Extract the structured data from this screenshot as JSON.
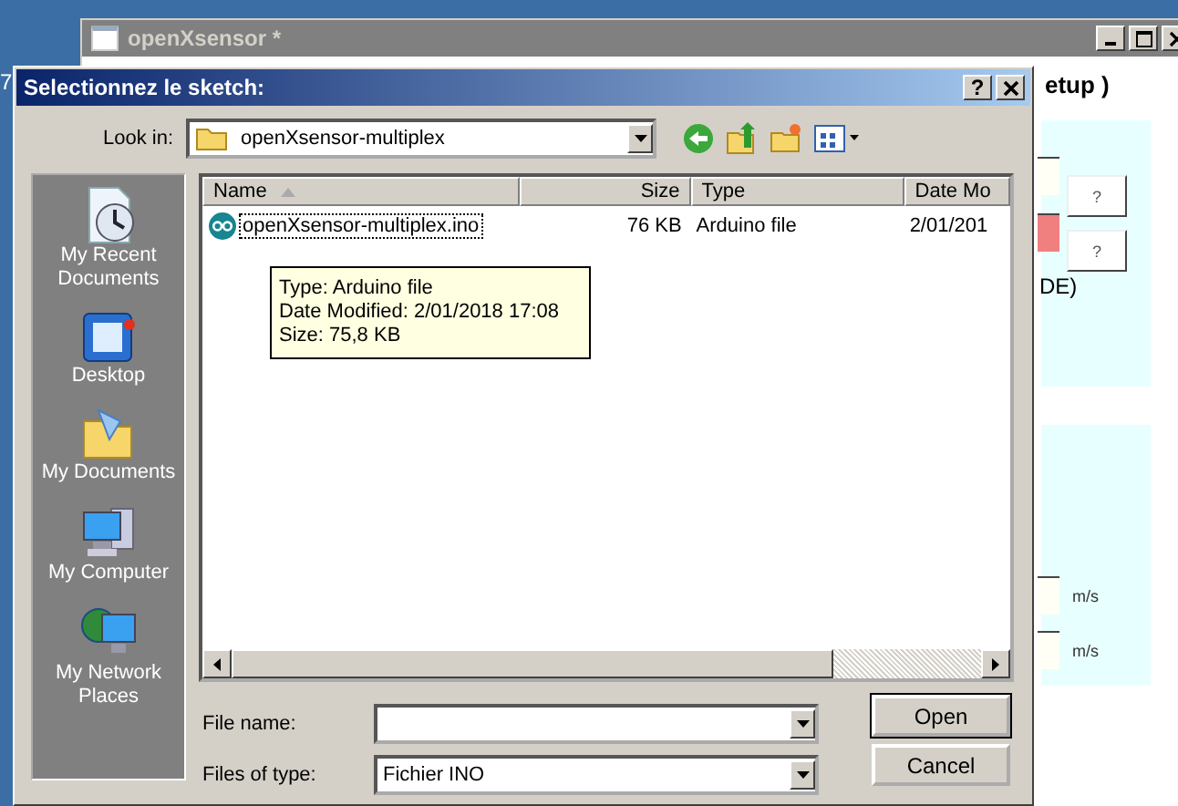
{
  "desktop_fragment": "7",
  "background_window": {
    "title": "openXsensor *",
    "heading_fragment": "etup )",
    "help_buttons": [
      "?",
      "?"
    ],
    "text_fragment": "DE)",
    "units": [
      "m/s",
      "m/s"
    ]
  },
  "dialog": {
    "title": "Selectionnez le sketch:",
    "help_button": "?",
    "look_in": {
      "label": "Look in:",
      "value": "openXsensor-multiplex"
    },
    "places": [
      {
        "label": "My Recent Documents",
        "kind": "recent"
      },
      {
        "label": "Desktop",
        "kind": "desktop"
      },
      {
        "label": "My Documents",
        "kind": "documents"
      },
      {
        "label": "My Computer",
        "kind": "computer"
      },
      {
        "label": "My Network Places",
        "kind": "network"
      }
    ],
    "columns": [
      {
        "label": "Name",
        "sorted": true
      },
      {
        "label": "Size"
      },
      {
        "label": "Type"
      },
      {
        "label": "Date Mo"
      }
    ],
    "files": [
      {
        "name": "openXsensor-multiplex.ino",
        "size": "76 KB",
        "type": "Arduino file",
        "date": "2/01/201",
        "focused": true
      }
    ],
    "tooltip": [
      "Type: Arduino file",
      "Date Modified: 2/01/2018 17:08",
      "Size: 75,8 KB"
    ],
    "file_name": {
      "label": "File name:"
    },
    "file_type": {
      "label": "Files of type:",
      "value": "Fichier INO"
    },
    "buttons": [
      "Open",
      "Cancel"
    ]
  }
}
